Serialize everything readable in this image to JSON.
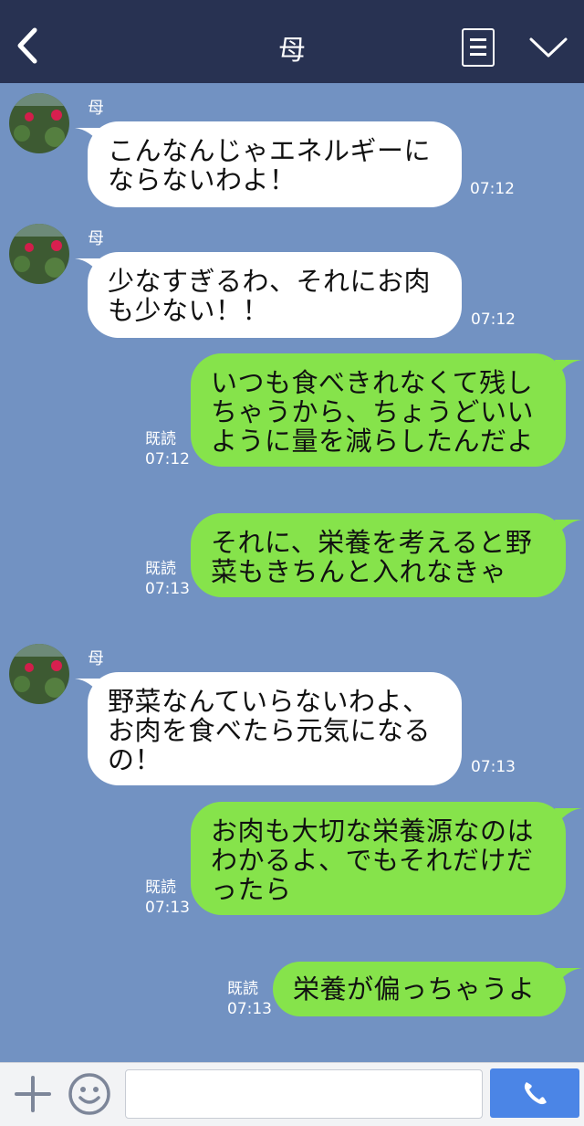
{
  "header": {
    "title": "母",
    "back_icon": "chevron-left-icon",
    "menu_icon": "list-icon",
    "collapse_icon": "chevron-down-icon"
  },
  "messages": [
    {
      "side": "in",
      "sender": "母",
      "lines": [
        "こんなんじゃエネルギーに",
        "ならないわよ！"
      ],
      "time": "07:12"
    },
    {
      "side": "in",
      "sender": "母",
      "lines": [
        "少なすぎるわ、それにお肉",
        "も少ない！！"
      ],
      "time": "07:12"
    },
    {
      "side": "out",
      "read": "既読",
      "lines": [
        "いつも食べきれなくて残し",
        "ちゃうから、ちょうどいい",
        "ように量を減らしたんだよ"
      ],
      "time": "07:12"
    },
    {
      "side": "out",
      "read": "既読",
      "lines": [
        "それに、栄養を考えると野",
        "菜もきちんと入れなきゃ"
      ],
      "time": "07:13"
    },
    {
      "side": "in",
      "sender": "母",
      "lines": [
        "野菜なんていらないわよ、",
        "お肉を食べたら元気になる",
        "の！"
      ],
      "time": "07:13"
    },
    {
      "side": "out",
      "read": "既読",
      "lines": [
        "お肉も大切な栄養源なのは",
        "わかるよ、でもそれだけだ",
        "ったら"
      ],
      "time": "07:13"
    },
    {
      "side": "out",
      "read": "既読",
      "lines": [
        "栄養が偏っちゃうよ"
      ],
      "time": "07:13"
    }
  ],
  "composer": {
    "input_value": "",
    "plus_icon": "plus-icon",
    "sticker_icon": "smile-icon",
    "call_icon": "phone-icon"
  },
  "colors": {
    "background": "#7292c2",
    "header": "#283252",
    "bubble_in": "#ffffff",
    "bubble_out": "#86e34b",
    "call_button": "#4b85e6"
  }
}
